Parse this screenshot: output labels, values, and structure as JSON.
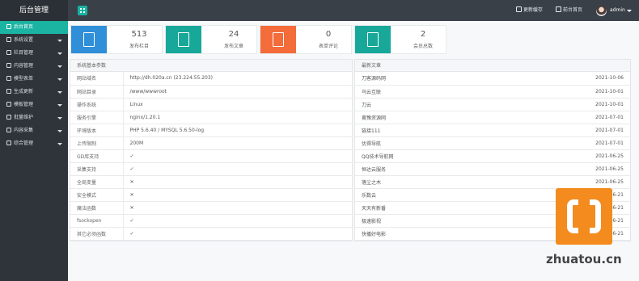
{
  "header": {
    "brand": "后台管理",
    "clear_cache": "更新缓存",
    "front_home": "前台首页",
    "user": "admin"
  },
  "sidebar": {
    "items": [
      {
        "label": "后台首页",
        "active": true,
        "has_submenu": false
      },
      {
        "label": "系统设置",
        "active": false,
        "has_submenu": true
      },
      {
        "label": "栏目管理",
        "active": false,
        "has_submenu": true
      },
      {
        "label": "内容管理",
        "active": false,
        "has_submenu": true
      },
      {
        "label": "模型表单",
        "active": false,
        "has_submenu": true
      },
      {
        "label": "生成更新",
        "active": false,
        "has_submenu": true
      },
      {
        "label": "模板管理",
        "active": false,
        "has_submenu": true
      },
      {
        "label": "批量维护",
        "active": false,
        "has_submenu": true
      },
      {
        "label": "内容采集",
        "active": false,
        "has_submenu": true
      },
      {
        "label": "综合管理",
        "active": false,
        "has_submenu": true
      }
    ]
  },
  "stats": [
    {
      "value": "513",
      "label": "发布栏目",
      "color": "#2f8fd8",
      "icon": "document-icon"
    },
    {
      "value": "24",
      "label": "发布文章",
      "color": "#17a89a",
      "icon": "image-icon"
    },
    {
      "value": "0",
      "label": "表单评论",
      "color": "#f36c3a",
      "icon": "chat-icon"
    },
    {
      "value": "2",
      "label": "会员总数",
      "color": "#17a89a",
      "icon": "users-icon"
    }
  ],
  "system": {
    "title": "系统基本参数",
    "rows": [
      {
        "key": "网站域名",
        "value": "http://dh.020a.cn (23.224.55.203)"
      },
      {
        "key": "网站目录",
        "value": "/www/wwwroot"
      },
      {
        "key": "操作系统",
        "value": "Linux"
      },
      {
        "key": "服务引擎",
        "value": "nginx/1.20.1"
      },
      {
        "key": "环境版本",
        "value": "PHP 5.6.40 / MYSQL 5.6.50-log"
      },
      {
        "key": "上传限制",
        "value": "200M"
      },
      {
        "key": "GD库支持",
        "value": "✓"
      },
      {
        "key": "采集支持",
        "value": "✓"
      },
      {
        "key": "全局变量",
        "value": "✕"
      },
      {
        "key": "安全模式",
        "value": "✕"
      },
      {
        "key": "魔法函数",
        "value": "✕"
      },
      {
        "key": "fsockopen",
        "value": "✓"
      },
      {
        "key": "其它必须函数",
        "value": "✓"
      }
    ]
  },
  "articles": {
    "title": "最新文章",
    "rows": [
      {
        "title": "刀客源码网",
        "date": "2021-10-06"
      },
      {
        "title": "乌云互联",
        "date": "2021-10-01"
      },
      {
        "title": "刀云",
        "date": "2021-10-01"
      },
      {
        "title": "黄豫资源网",
        "date": "2021-07-01"
      },
      {
        "title": "链接111",
        "date": "2021-07-01"
      },
      {
        "title": "优得导航",
        "date": "2021-07-01"
      },
      {
        "title": "QQ技术导航网",
        "date": "2021-06-25"
      },
      {
        "title": "恒达云服务",
        "date": "2021-06-25"
      },
      {
        "title": "落尘之木",
        "date": "2021-06-25"
      },
      {
        "title": "乐数云",
        "date": "2021-06-21"
      },
      {
        "title": "天天有新番",
        "date": "2021-06-21"
      },
      {
        "title": "极速影视",
        "date": "2021-06-21"
      },
      {
        "title": "快播好电影",
        "date": "2021-06-21"
      }
    ]
  },
  "watermark": {
    "text": "zhuatou.cn",
    "color": "#f38b1f"
  }
}
